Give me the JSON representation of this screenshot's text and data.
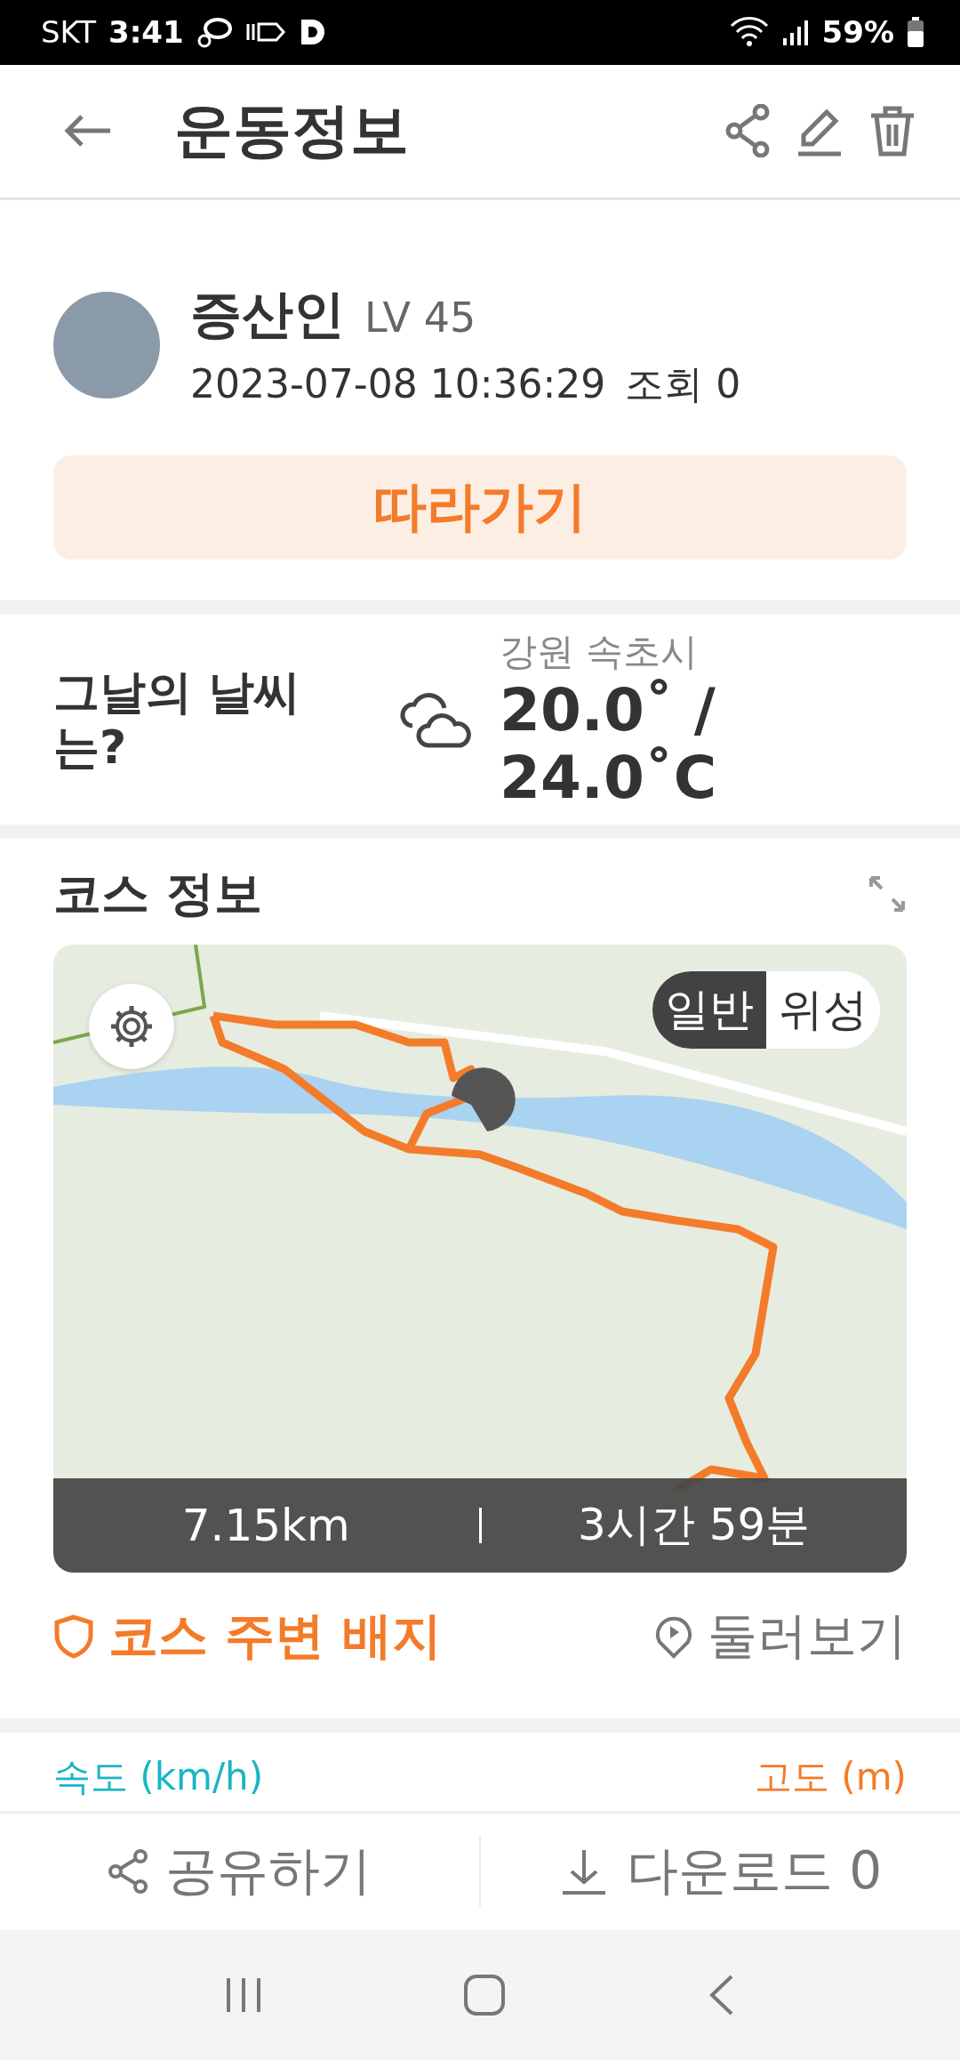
{
  "status_bar": {
    "carrier": "SKT",
    "time": "3:41",
    "battery": "59%"
  },
  "header": {
    "title": "운동정보"
  },
  "profile": {
    "name": "증산인",
    "level": "LV 45",
    "datetime": "2023-07-08 10:36:29",
    "views": "조회 0"
  },
  "follow_button": {
    "label": "따라가기"
  },
  "weather": {
    "heading": "그날의 날씨는?",
    "location": "강원 속초시",
    "temperature": "20.0˚ / 24.0˚C"
  },
  "course": {
    "heading": "코스 정보",
    "map_types": [
      {
        "label": "일반",
        "selected": true
      },
      {
        "label": "위성",
        "selected": false
      }
    ],
    "distance": "7.15km",
    "duration": "3시간 59분",
    "badge_link": "코스 주변 배지",
    "tour_link": "둘러보기"
  },
  "chart_labels": {
    "left": "속도 (km/h)",
    "right": "고도 (m)"
  },
  "bottom_bar": {
    "share": "공유하기",
    "download": "다운로드 0"
  }
}
